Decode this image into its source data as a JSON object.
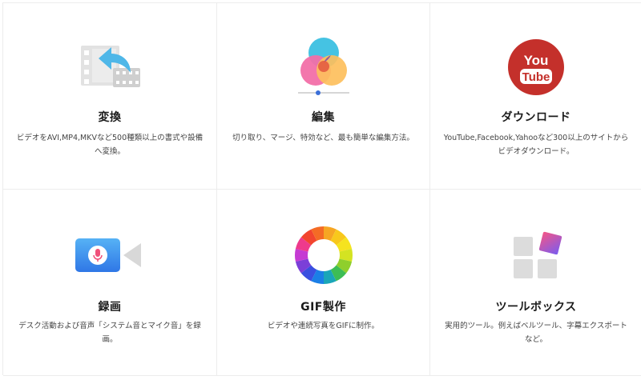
{
  "features": [
    {
      "title": "変換",
      "description": "ビデオをAVI,MP4,MKVなど500種類以上の書式や設備へ変換。",
      "icon": "video-convert-icon"
    },
    {
      "title": "編集",
      "description": "切り取り、マージ、特効など、最も簡単な編集方法。",
      "icon": "color-edit-icon"
    },
    {
      "title": "ダウンロード",
      "description": "YouTube,Facebook,Yahooなど300以上のサイトからビデオダウンロード。",
      "icon": "youtube-icon",
      "icon_text_top": "You",
      "icon_text_bottom": "Tube"
    },
    {
      "title": "録画",
      "description": "デスク活動および音声「システム音とマイク音」を録画。",
      "icon": "record-camera-icon"
    },
    {
      "title": "GIF製作",
      "description": "ビデオや連続写真をGIFに制作。",
      "icon": "gif-color-wheel-icon"
    },
    {
      "title": "ツールボックス",
      "description": "実用的ツール。例えばベルツール、字幕エクスポートなど。",
      "icon": "toolbox-icon"
    }
  ],
  "colors": {
    "youtube_red": "#c4302b",
    "edit_blue": "#45c3e3",
    "edit_pink": "#f26fa8",
    "edit_orange": "#fdbf5c",
    "record_blue": "#3b8ff0"
  }
}
